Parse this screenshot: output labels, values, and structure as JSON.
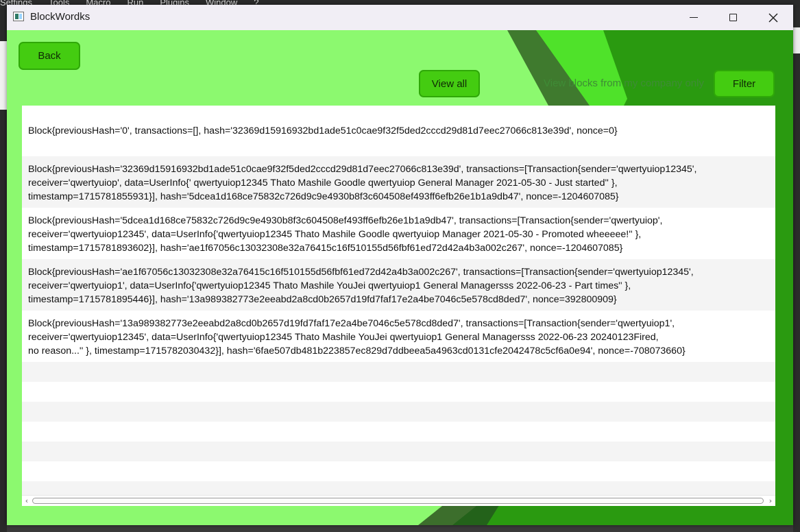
{
  "background_menu": [
    "Settings",
    "Tools",
    "Macro",
    "Run",
    "Plugins",
    "Window",
    "?"
  ],
  "window": {
    "title": "BlockWordks",
    "minimize_label": "minimize",
    "maximize_label": "maximize",
    "close_label": "close"
  },
  "toolbar": {
    "back_label": "Back",
    "view_all_label": "View all",
    "filter_hint": "View blocks from my company only",
    "filter_label": "Filter"
  },
  "blocks": [
    {
      "lines": [
        "Block{previousHash='0', transactions=[], hash='32369d15916932bd1ade51c0cae9f32f5ded2cccd29d81d7eec27066c813e39d', nonce=0}"
      ]
    },
    {
      "lines": [
        "Block{previousHash='32369d15916932bd1ade51c0cae9f32f5ded2cccd29d81d7eec27066c813e39d', transactions=[Transaction{sender='qwertyuiop12345',",
        "receiver='qwertyuiop', data=UserInfo{'  qwertyuiop12345    Thato     Mashile    Goodle    qwertyuiop     General Manager    2021-05-30     -      Just started''   },",
        "timestamp=1715781855931}], hash='5dcea1d168ce75832c726d9c9e4930b8f3c604508ef493ff6efb26e1b1a9db47', nonce=-1204607085}"
      ]
    },
    {
      "lines": [
        "Block{previousHash='5dcea1d168ce75832c726d9c9e4930b8f3c604508ef493ff6efb26e1b1a9db47', transactions=[Transaction{sender='qwertyuiop',",
        "receiver='qwertyuiop12345', data=UserInfo{'qwertyuiop12345    Thato     Mashile    Goodle    qwertyuiop    Manager 2021-05-30    -    Promoted wheeeee!''   },",
        "timestamp=1715781893602}], hash='ae1f67056c13032308e32a76415c16f510155d56fbf61ed72d42a4b3a002c267', nonce=-1204607085}"
      ]
    },
    {
      "lines": [
        "Block{previousHash='ae1f67056c13032308e32a76415c16f510155d56fbf61ed72d42a4b3a002c267', transactions=[Transaction{sender='qwertyuiop12345',",
        "receiver='qwertyuiop1', data=UserInfo{'qwertyuiop12345    Thato     Mashile    YouJei    qwertyuiop1    General Managersss     2022-06-23    -    Part times''   },",
        "timestamp=1715781895446}], hash='13a989382773e2eeabd2a8cd0b2657d19fd7faf17e2a4be7046c5e578cd8ded7', nonce=392800909}"
      ]
    },
    {
      "lines": [
        "Block{previousHash='13a989382773e2eeabd2a8cd0b2657d19fd7faf17e2a4be7046c5e578cd8ded7', transactions=[Transaction{sender='qwertyuiop1',",
        "receiver='qwertyuiop12345', data=UserInfo{'qwertyuiop12345    Thato     Mashile    YouJei    qwertyuiop1    General Managersss     2022-06-23    20240123Fired,",
        "no reason...''    }, timestamp=1715782030432}], hash='6fae507db481b223857ec829d7ddbeea5a4963cd0131cfe2042478c5cf6a0e94', nonce=-708073660}"
      ]
    }
  ],
  "colors": {
    "window_bg": "#8cf96f",
    "button_green": "#44cc11",
    "decor_dark_green": "#2a9a10",
    "decor_mid_green": "#3c6e2c"
  },
  "icons": {
    "app": "app-window-icon",
    "minimize": "minimize-icon",
    "maximize": "maximize-icon",
    "close": "close-icon",
    "scroll_left": "chevron-left-icon",
    "scroll_right": "chevron-right-icon"
  }
}
